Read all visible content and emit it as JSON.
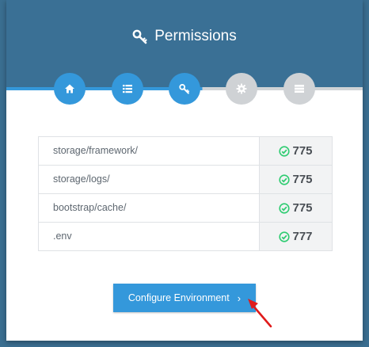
{
  "header": {
    "title": "Permissions",
    "title_icon": "key-icon"
  },
  "steps": [
    {
      "name": "welcome",
      "icon": "home-icon",
      "state": "complete"
    },
    {
      "name": "requirements",
      "icon": "list-icon",
      "state": "complete"
    },
    {
      "name": "permissions",
      "icon": "key-icon",
      "state": "current"
    },
    {
      "name": "environment",
      "icon": "gear-icon",
      "state": "pending"
    },
    {
      "name": "final",
      "icon": "server-icon",
      "state": "pending"
    }
  ],
  "permissions": [
    {
      "path": "storage/framework/",
      "value": "775",
      "ok": true
    },
    {
      "path": "storage/logs/",
      "value": "775",
      "ok": true
    },
    {
      "path": "bootstrap/cache/",
      "value": "775",
      "ok": true
    },
    {
      "path": ".env",
      "value": "777",
      "ok": true
    }
  ],
  "actions": {
    "configure_label": "Configure Environment",
    "configure_chevron": "›"
  },
  "colors": {
    "accent": "#3498db",
    "header": "#3a7095",
    "success": "#2ecc71",
    "annotation": "#e01b1b"
  }
}
